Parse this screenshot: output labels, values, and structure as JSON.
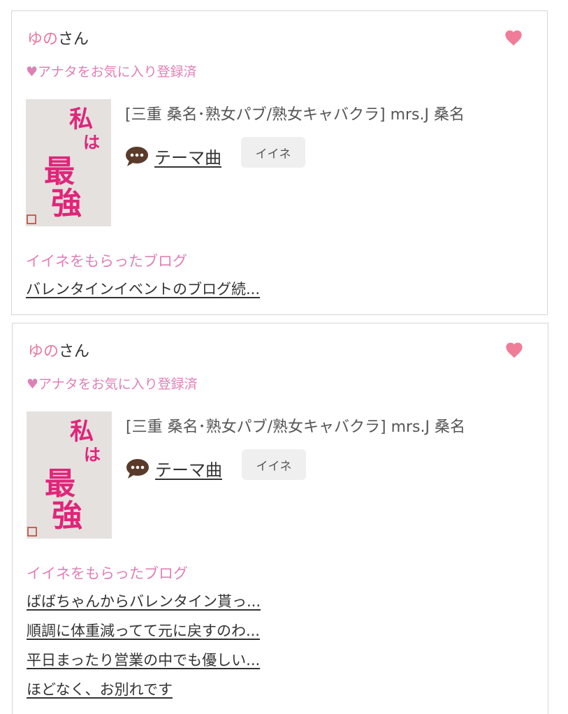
{
  "cards": [
    {
      "user_name": "ゆの",
      "honorific": "さん",
      "favorited_text": "♥アナタをお気に入り登録済",
      "thumbnail_lines": [
        "私",
        "は",
        "最",
        "強"
      ],
      "shop": "[三重 桑名･熟女パブ/熟女キャバクラ]  mrs.J 桑名",
      "theme_label": "テーマ曲",
      "iine_label": "イイネ",
      "received_header": "イイネをもらったブログ",
      "blogs": [
        "バレンタインイベントのブログ続..."
      ]
    },
    {
      "user_name": "ゆの",
      "honorific": "さん",
      "favorited_text": "♥アナタをお気に入り登録済",
      "thumbnail_lines": [
        "私",
        "は",
        "最",
        "強"
      ],
      "shop": "[三重 桑名･熟女パブ/熟女キャバクラ]  mrs.J 桑名",
      "theme_label": "テーマ曲",
      "iine_label": "イイネ",
      "received_header": "イイネをもらったブログ",
      "blogs": [
        "ばばちゃんからバレンタイン貰っ...",
        "順調に体重減ってて元に戻すのわ...",
        "平日まったり営業の中でも優しい...",
        "ほどなく、お別れです"
      ]
    }
  ],
  "colors": {
    "accent_pink": "#e07fb6",
    "heart": "#ef7d97",
    "name": "#e8799e"
  },
  "icons": {
    "favorite": "heart-icon",
    "comment": "speech-bubble-icon"
  }
}
